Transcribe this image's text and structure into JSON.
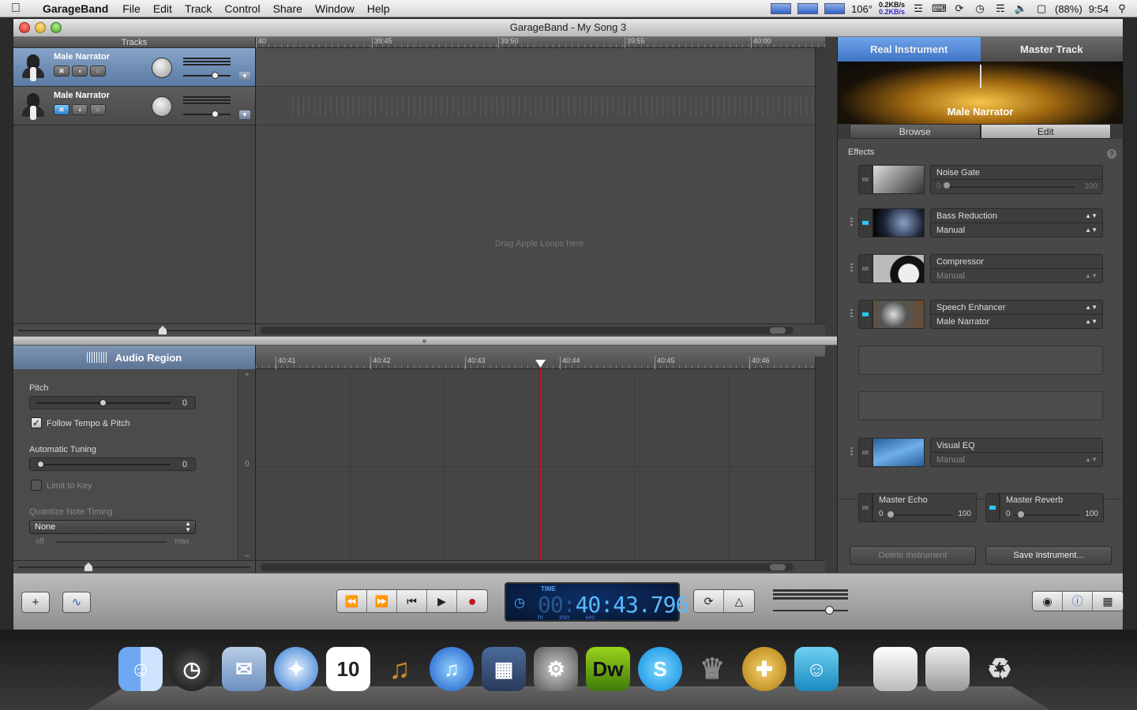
{
  "menubar": {
    "app_name": "GarageBand",
    "menus": [
      "File",
      "Edit",
      "Track",
      "Control",
      "Share",
      "Window",
      "Help"
    ],
    "temperature": "106°",
    "net_up": "0.2KB/s",
    "net_down": "0.2KB/s",
    "battery": "(88%)",
    "clock": "9:54"
  },
  "window": {
    "title": "GarageBand - My Song 3"
  },
  "tracks": {
    "header": "Tracks",
    "items": [
      {
        "name": "Male Narrator",
        "selected": true
      },
      {
        "name": "Male Narrator",
        "selected": false
      }
    ]
  },
  "timeline": {
    "ruler_labels": [
      "40",
      "39:45",
      "39:50",
      "39:55",
      "40:00"
    ],
    "drag_hint": "Drag Apple Loops here."
  },
  "editor": {
    "header": "Audio Region",
    "pitch_label": "Pitch",
    "pitch_value": "0",
    "follow_tempo_label": "Follow Tempo & Pitch",
    "follow_tempo_checked": true,
    "auto_tuning_label": "Automatic Tuning",
    "auto_tuning_value": "0",
    "limit_key_label": "Limit to Key",
    "quantize_label": "Quantize Note Timing",
    "quantize_value": "None",
    "quantize_off": "off",
    "quantize_max": "max",
    "plus": "+",
    "minus": "–",
    "zero": "0",
    "ruler_labels": [
      "40:41",
      "40:42",
      "40:43",
      "40:44",
      "40:45",
      "40:46"
    ]
  },
  "inspector": {
    "tabs": [
      "Real Instrument",
      "Master Track"
    ],
    "instrument_name": "Male Narrator",
    "subtabs": [
      "Browse",
      "Edit"
    ],
    "effects_title": "Effects",
    "help": "?",
    "effects": [
      {
        "name": "Noise Gate",
        "type": "slider",
        "lo": "0",
        "hi": "100",
        "level": 0,
        "on": false
      },
      {
        "name": "Bass Reduction",
        "preset": "Manual",
        "on": true
      },
      {
        "name": "Compressor",
        "preset": "Manual",
        "on": false,
        "preset_dim": true
      },
      {
        "name": "Speech Enhancer",
        "preset": "Male Narrator",
        "on": true
      },
      {
        "name": "Visual EQ",
        "preset": "Manual",
        "on": false,
        "preset_dim": true
      }
    ],
    "master_echo": {
      "name": "Master Echo",
      "lo": "0",
      "hi": "100",
      "on": false
    },
    "master_reverb": {
      "name": "Master Reverb",
      "lo": "0",
      "hi": "100",
      "on": true
    },
    "delete_button": "Delete Instrument",
    "save_button": "Save Instrument..."
  },
  "controlbar": {
    "add_label": "+",
    "lcd_label": "TIME",
    "time_dim": "00:",
    "time": "40:43.796",
    "units": "hr min sec"
  },
  "colors": {
    "accent": "#3f74c4",
    "lcd_text": "#5bb9ff",
    "playhead": "#d01818",
    "fx_on": "#27c8f5"
  }
}
